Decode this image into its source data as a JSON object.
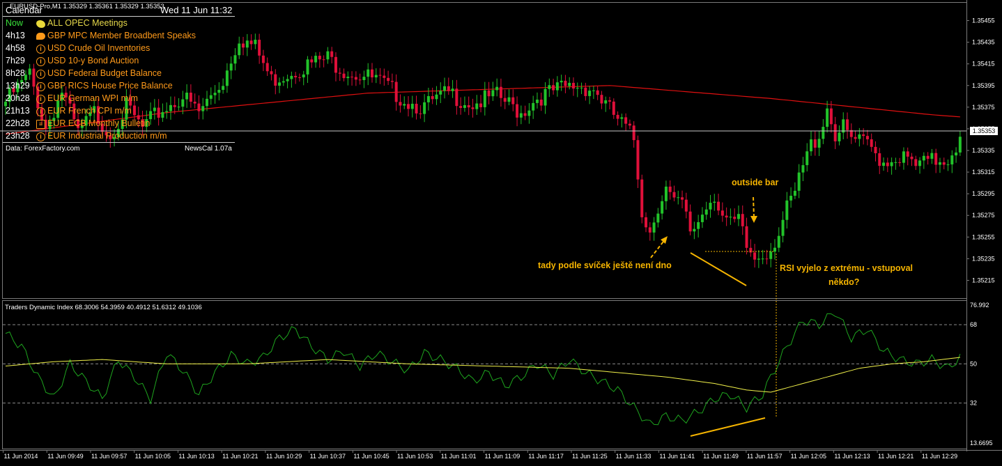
{
  "chart_header": {
    "symbol_line": "EURUSD-Pro,M1  1.35329 1.35361 1.35329 1.35353"
  },
  "calendar": {
    "title": "Calendar",
    "datetime": "Wed 11 Jun 11:32",
    "events": [
      {
        "time": "Now",
        "icon": "meeting-icon",
        "text": "ALL  OPEC Meetings",
        "time_color": "#39e03a",
        "text_color": "#e6d84a"
      },
      {
        "time": "4h13",
        "icon": "speech-icon",
        "text": "GBP MPC Member Broadbent Speaks",
        "time_color": "#ffffff",
        "text_color": "#ff9a1a"
      },
      {
        "time": "4h58",
        "icon": "info-icon",
        "text": "USD Crude Oil Inventories",
        "time_color": "#ffffff",
        "text_color": "#ff9a1a"
      },
      {
        "time": "7h29",
        "icon": "info-icon",
        "text": "USD 10-y Bond Auction",
        "time_color": "#ffffff",
        "text_color": "#ff9a1a"
      },
      {
        "time": "8h28",
        "icon": "info-icon",
        "text": "USD Federal Budget Balance",
        "time_color": "#ffffff",
        "text_color": "#ff9a1a"
      },
      {
        "time": "13h29",
        "icon": "info-icon",
        "text": "GBP RICS House Price Balance",
        "time_color": "#ffffff",
        "text_color": "#ff9a1a"
      },
      {
        "time": "20h28",
        "icon": "info-icon",
        "text": "EUR German WPI m/m",
        "time_color": "#ffffff",
        "text_color": "#ff9a1a"
      },
      {
        "time": "21h13",
        "icon": "info-icon",
        "text": "EUR French CPI m/m",
        "time_color": "#ffffff",
        "text_color": "#ff9a1a"
      },
      {
        "time": "22h28",
        "icon": "document-icon",
        "text": "EUR ECB Monthly Bulletin",
        "time_color": "#ffffff",
        "text_color": "#ff9a1a"
      },
      {
        "time": "23h28",
        "icon": "info-icon",
        "text": "EUR Industrial Production m/m",
        "time_color": "#ffffff",
        "text_color": "#ff9a1a"
      }
    ],
    "source": "Data: ForexFactory.com",
    "version": "NewsCal 1.07a"
  },
  "annotations": {
    "outside_bar": "outside bar",
    "no_bottom": "tady podle svíček ještě není dno",
    "rsi_line1": "RSI vyjelo z extrému - vstupoval",
    "rsi_line2": "někdo?"
  },
  "indicator": {
    "label": "Traders Dynamic Index 68.3006 54.3959 40.4912 51.6312 49.1036"
  },
  "colors": {
    "bull": "#22c32a",
    "bear": "#e0103a",
    "ma": "#e01010",
    "tdi_green": "#1ea51e",
    "tdi_yellow": "#f2f24a",
    "annotation": "#f5b400",
    "grid": "#7a7a7a"
  },
  "chart_data": [
    {
      "type": "candlestick",
      "title": "EURUSD-Pro,M1",
      "y_ticks": [
        "1.35455",
        "1.35435",
        "1.35415",
        "1.35395",
        "1.35375",
        "1.35355",
        "1.35335",
        "1.35315",
        "1.35295",
        "1.35275",
        "1.35255",
        "1.35235",
        "1.35215"
      ],
      "ylim": [
        1.35205,
        1.35465
      ],
      "current_price": "1.35353",
      "x_ticks": [
        "11 Jun 2014",
        "11 Jun 09:49",
        "11 Jun 09:57",
        "11 Jun 10:05",
        "11 Jun 10:13",
        "11 Jun 10:21",
        "11 Jun 10:29",
        "11 Jun 10:37",
        "11 Jun 10:45",
        "11 Jun 10:53",
        "11 Jun 11:01",
        "11 Jun 11:09",
        "11 Jun 11:17",
        "11 Jun 11:25",
        "11 Jun 11:33",
        "11 Jun 11:41",
        "11 Jun 11:49",
        "11 Jun 11:57",
        "11 Jun 12:05",
        "11 Jun 12:13",
        "11 Jun 12:21",
        "11 Jun 12:29"
      ],
      "close_anchors": [
        [
          0,
          1.3538
        ],
        [
          6,
          1.35405
        ],
        [
          10,
          1.35355
        ],
        [
          14,
          1.3539
        ],
        [
          18,
          1.3535
        ],
        [
          22,
          1.3537
        ],
        [
          26,
          1.3535
        ],
        [
          30,
          1.35375
        ],
        [
          34,
          1.35355
        ],
        [
          38,
          1.3537
        ],
        [
          44,
          1.35385
        ],
        [
          48,
          1.3537
        ],
        [
          54,
          1.354
        ],
        [
          58,
          1.3544
        ],
        [
          62,
          1.3543
        ],
        [
          66,
          1.354
        ],
        [
          72,
          1.3541
        ],
        [
          80,
          1.3542
        ],
        [
          84,
          1.3541
        ],
        [
          88,
          1.35405
        ],
        [
          92,
          1.354
        ],
        [
          96,
          1.3539
        ],
        [
          100,
          1.3538
        ],
        [
          104,
          1.35375
        ],
        [
          110,
          1.35388
        ],
        [
          116,
          1.35378
        ],
        [
          122,
          1.35385
        ],
        [
          128,
          1.3537
        ],
        [
          132,
          1.35384
        ],
        [
          138,
          1.35392
        ],
        [
          142,
          1.35395
        ],
        [
          146,
          1.35392
        ],
        [
          150,
          1.35372
        ],
        [
          154,
          1.35355
        ],
        [
          156,
          1.35345
        ],
        [
          158,
          1.3528
        ],
        [
          160,
          1.3526
        ],
        [
          162,
          1.35285
        ],
        [
          164,
          1.353
        ],
        [
          166,
          1.35285
        ],
        [
          168,
          1.35285
        ],
        [
          170,
          1.3526
        ],
        [
          172,
          1.3527
        ],
        [
          174,
          1.35285
        ],
        [
          176,
          1.35295
        ],
        [
          178,
          1.35275
        ],
        [
          180,
          1.35265
        ],
        [
          182,
          1.3527
        ],
        [
          184,
          1.35245
        ],
        [
          186,
          1.35235
        ],
        [
          188,
          1.3524
        ],
        [
          190,
          1.35245
        ],
        [
          192,
          1.3526
        ],
        [
          194,
          1.3528
        ],
        [
          196,
          1.35295
        ],
        [
          198,
          1.3532
        ],
        [
          200,
          1.3534
        ],
        [
          202,
          1.3535
        ],
        [
          204,
          1.35375
        ],
        [
          206,
          1.3535
        ],
        [
          208,
          1.35355
        ],
        [
          210,
          1.35345
        ],
        [
          214,
          1.3534
        ],
        [
          218,
          1.35325
        ],
        [
          222,
          1.3533
        ],
        [
          226,
          1.3532
        ],
        [
          230,
          1.35325
        ],
        [
          234,
          1.35328
        ],
        [
          236,
          1.3534
        ],
        [
          237,
          1.35353
        ]
      ],
      "moving_average": [
        [
          0,
          1.3535
        ],
        [
          40,
          1.3537
        ],
        [
          90,
          1.35388
        ],
        [
          150,
          1.35395
        ],
        [
          190,
          1.35383
        ],
        [
          230,
          1.35368
        ],
        [
          237,
          1.35366
        ]
      ]
    },
    {
      "type": "line",
      "title": "Traders Dynamic Index",
      "y_ticks": [
        "76.992",
        "68",
        "50",
        "32",
        "13.6695"
      ],
      "levels": [
        68,
        50,
        32
      ],
      "ylim": [
        13.6695,
        76.992
      ],
      "series": [
        {
          "name": "fast",
          "color": "#1ea51e",
          "anchors": [
            [
              0,
              64
            ],
            [
              4,
              58
            ],
            [
              8,
              44
            ],
            [
              12,
              34
            ],
            [
              16,
              50
            ],
            [
              20,
              42
            ],
            [
              24,
              34
            ],
            [
              28,
              52
            ],
            [
              32,
              44
            ],
            [
              36,
              34
            ],
            [
              40,
              55
            ],
            [
              44,
              47
            ],
            [
              48,
              36
            ],
            [
              52,
              46
            ],
            [
              56,
              54
            ],
            [
              60,
              50
            ],
            [
              64,
              53
            ],
            [
              68,
              62
            ],
            [
              72,
              66
            ],
            [
              76,
              58
            ],
            [
              80,
              52
            ],
            [
              84,
              56
            ],
            [
              88,
              49
            ],
            [
              92,
              55
            ],
            [
              96,
              51
            ],
            [
              100,
              47
            ],
            [
              104,
              55
            ],
            [
              108,
              52
            ],
            [
              112,
              48
            ],
            [
              116,
              42
            ],
            [
              120,
              46
            ],
            [
              124,
              40
            ],
            [
              128,
              44
            ],
            [
              132,
              50
            ],
            [
              136,
              45
            ],
            [
              140,
              52
            ],
            [
              144,
              46
            ],
            [
              148,
              42
            ],
            [
              152,
              38
            ],
            [
              156,
              30
            ],
            [
              160,
              22
            ],
            [
              164,
              26
            ],
            [
              168,
              24
            ],
            [
              172,
              28
            ],
            [
              176,
              34
            ],
            [
              180,
              36
            ],
            [
              184,
              30
            ],
            [
              188,
              36
            ],
            [
              190,
              44
            ],
            [
              194,
              58
            ],
            [
              198,
              70
            ],
            [
              202,
              68
            ],
            [
              206,
              74
            ],
            [
              210,
              62
            ],
            [
              214,
              66
            ],
            [
              218,
              56
            ],
            [
              222,
              52
            ],
            [
              226,
              50
            ],
            [
              230,
              52
            ],
            [
              234,
              48
            ],
            [
              237,
              53
            ]
          ]
        },
        {
          "name": "signal",
          "color": "#f2f24a",
          "anchors": [
            [
              0,
              49
            ],
            [
              12,
              51
            ],
            [
              24,
              52
            ],
            [
              40,
              50
            ],
            [
              60,
              50
            ],
            [
              80,
              52
            ],
            [
              100,
              50
            ],
            [
              120,
              49
            ],
            [
              140,
              48
            ],
            [
              152,
              46
            ],
            [
              164,
              44
            ],
            [
              176,
              41
            ],
            [
              184,
              38
            ],
            [
              190,
              37
            ],
            [
              196,
              40
            ],
            [
              204,
              44
            ],
            [
              212,
              48
            ],
            [
              220,
              50
            ],
            [
              228,
              51
            ],
            [
              237,
              53
            ]
          ]
        }
      ]
    }
  ]
}
